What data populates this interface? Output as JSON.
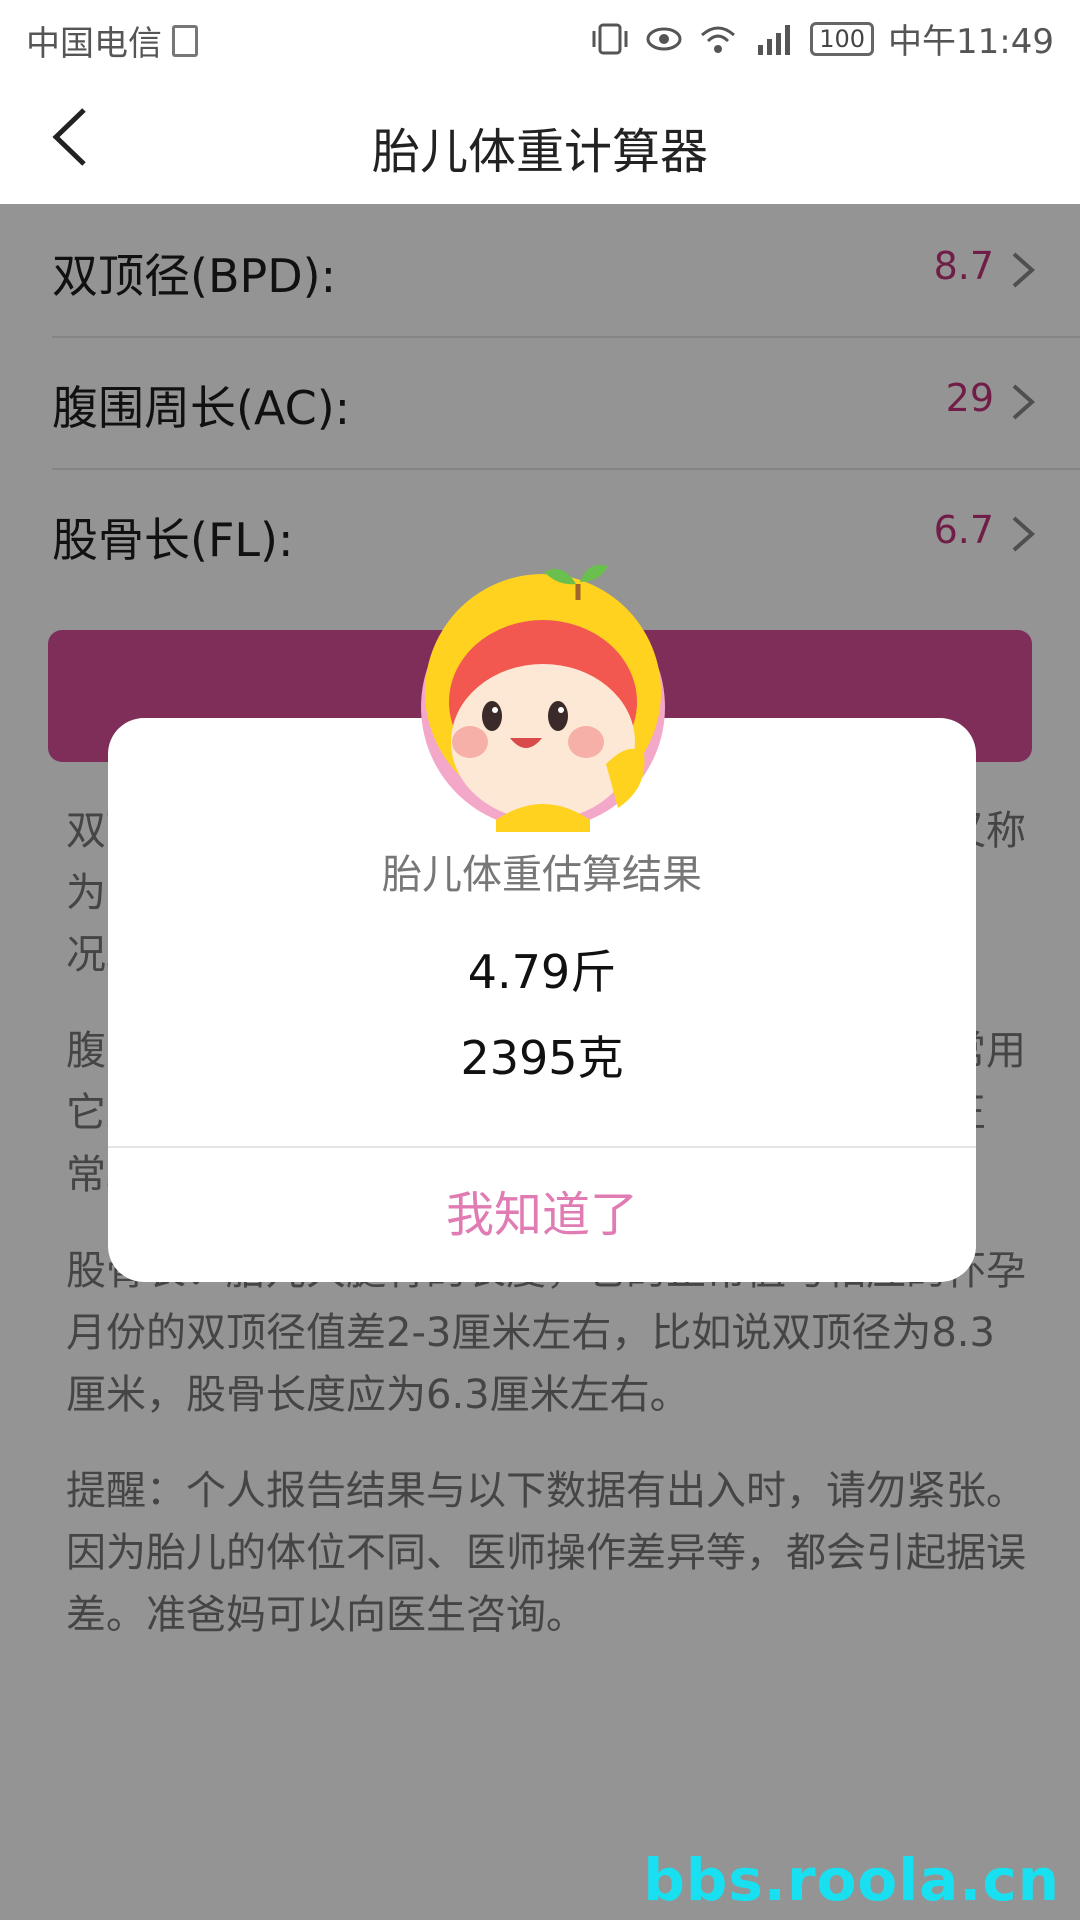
{
  "status_bar": {
    "carrier": "中国电信",
    "battery": "100",
    "time": "中午11:49"
  },
  "header": {
    "title": "胎儿体重计算器"
  },
  "form": {
    "rows": [
      {
        "label": "双顶径(BPD):",
        "value": "8.7"
      },
      {
        "label": "腹围周长(AC):",
        "value": "29"
      },
      {
        "label": "股骨长(FL):",
        "value": "6.7"
      }
    ]
  },
  "description": {
    "p1": "双顶径：胎儿头部左右两侧之间最宽部位的长度，又称为“头部大横径”，医生常用它来观察胎儿发育的情况。",
    "p2": "腹围：也称腹部周长，胎儿腹部一周的长度，医生常用它来与胎儿的头围相比较，以判断胎儿的发育是否正常。",
    "p3": "股骨长：胎儿大腿骨的长度，它的正常值与相应的怀孕月份的双顶径值差2-3厘米左右，比如说双顶径为8.3厘米，股骨长度应为6.3厘米左右。",
    "p4": "提醒：个人报告结果与以下数据有出入时，请勿紧张。因为胎儿的体位不同、医师操作差异等，都会引起据误差。准爸妈可以向医生咨询。"
  },
  "dialog": {
    "title": "胎儿体重估算结果",
    "weight_jin": "4.79斤",
    "weight_gram": "2395克",
    "ok_label": "我知道了"
  },
  "watermark": "bbs.roola.cn",
  "colors": {
    "accent": "#c2357a",
    "ok_text": "#e17bb3",
    "button": "#d9509a"
  },
  "icons": [
    "back-icon",
    "chevron-right-icon",
    "wifi-icon",
    "signal-icon",
    "battery-icon",
    "mascot-icon"
  ]
}
